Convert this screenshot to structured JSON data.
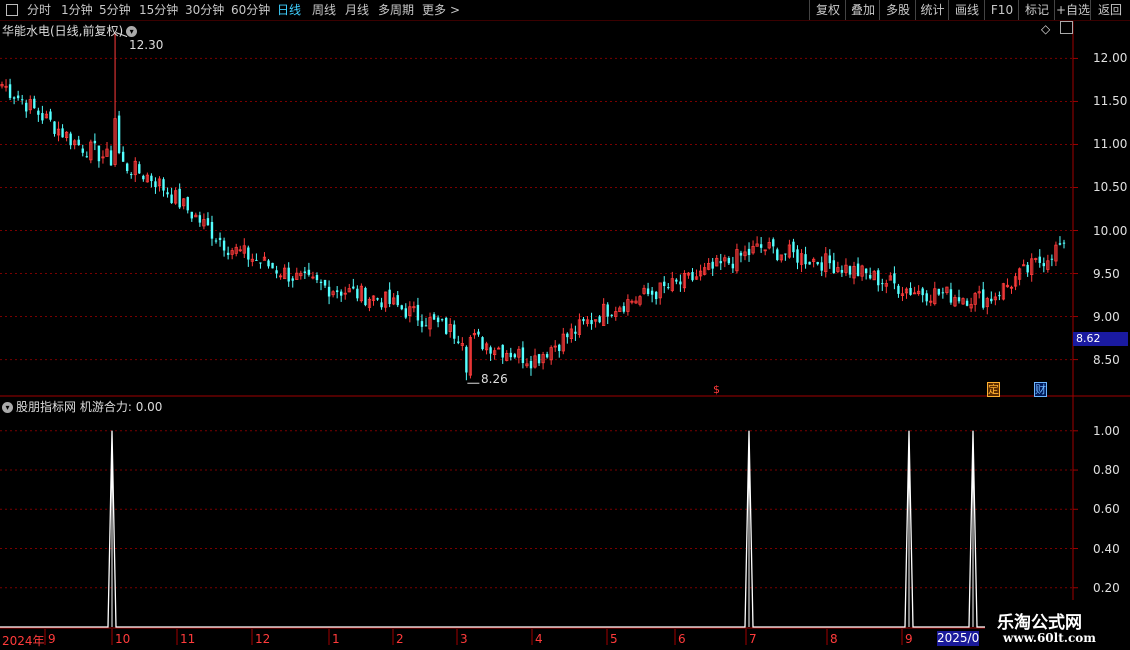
{
  "toolbar": {
    "left_items": [
      "分时",
      "1分钟",
      "5分钟",
      "15分钟",
      "30分钟",
      "60分钟",
      "日线",
      "周线",
      "月线",
      "多周期",
      "更多"
    ],
    "active": "日线",
    "more_arrow": ">",
    "right_items": [
      "复权",
      "叠加",
      "多股",
      "统计",
      "画线",
      "F10",
      "标记",
      "+自选",
      "返回"
    ]
  },
  "main": {
    "title": "华能水电(日线,前复权)",
    "high_label": "12.30",
    "low_label": "8.26",
    "current_price": "8.62",
    "price_ticks": [
      "12.00",
      "11.50",
      "11.00",
      "10.50",
      "10.00",
      "9.50",
      "9.00",
      "8.50"
    ],
    "marker_s": "$",
    "marker_ding": "定",
    "marker_cai": "财"
  },
  "sub": {
    "title": "股朋指标网",
    "indicator": "机游合力: 0.00",
    "ticks": [
      "1.00",
      "0.80",
      "0.60",
      "0.40",
      "0.20"
    ]
  },
  "xaxis": {
    "year_label": "2024年",
    "labels": [
      "9",
      "10",
      "11",
      "12",
      "1",
      "2",
      "3",
      "4",
      "5",
      "6",
      "7",
      "8",
      "9"
    ],
    "current_date": "2025/0"
  },
  "watermark": {
    "title": "乐淘公式网",
    "url": "www.60lt.com"
  },
  "colors": {
    "up": "#ff3b3b",
    "down": "#54ffff",
    "grid": "#7a0000",
    "axis": "#a00000",
    "indicator": "#ffffff"
  },
  "chart_data": [
    {
      "type": "candlestick",
      "title": "华能水电(日线,前复权)",
      "ylim": [
        8.1,
        12.4
      ],
      "x": [
        "2024-08",
        "2024-09",
        "2024-10",
        "2024-11",
        "2024-12",
        "2025-01",
        "2025-02",
        "2025-03",
        "2025-04",
        "2025-05",
        "2025-06",
        "2025-07",
        "2025-08",
        "2025-09",
        "2025-10"
      ],
      "close": [
        11.7,
        11.0,
        10.6,
        9.8,
        9.4,
        9.2,
        8.8,
        8.5,
        9.1,
        9.4,
        9.8,
        9.6,
        9.3,
        9.2,
        9.85
      ],
      "high": 12.3,
      "low": 8.26,
      "last": 8.62
    },
    {
      "type": "line",
      "title": "机游合力",
      "ylim": [
        0,
        1.05
      ],
      "series": [
        {
          "name": "机游合力",
          "x": [
            "2024-10-08",
            "2025-07-01",
            "2025-09-08",
            "2025-09-30"
          ],
          "values": [
            1.0,
            1.0,
            1.0,
            1.0
          ]
        }
      ],
      "baseline": 0
    }
  ]
}
